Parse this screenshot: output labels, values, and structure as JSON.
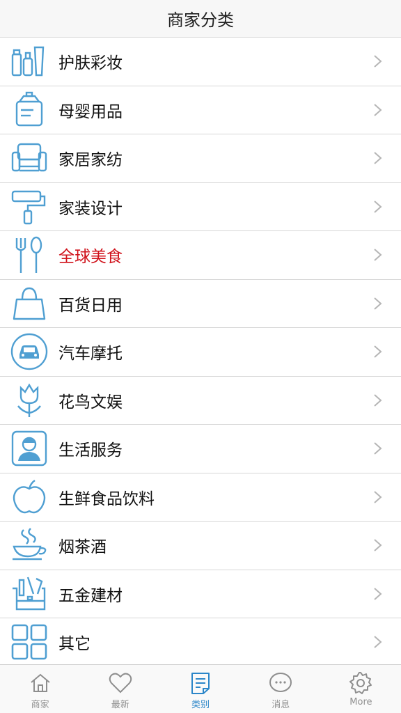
{
  "header": {
    "title": "商家分类"
  },
  "colors": {
    "accent": "#2b86c9",
    "icon_blue": "#4f9fd2",
    "highlight_red": "#d0121b"
  },
  "categories": [
    {
      "label": "护肤彩妆",
      "icon": "cosmetics-icon"
    },
    {
      "label": "母婴用品",
      "icon": "baby-bottle-icon"
    },
    {
      "label": "家居家纺",
      "icon": "sofa-icon"
    },
    {
      "label": "家装设计",
      "icon": "paint-roller-icon"
    },
    {
      "label": "全球美食",
      "icon": "fork-spoon-icon",
      "highlighted": true
    },
    {
      "label": "百货日用",
      "icon": "shopping-bag-icon"
    },
    {
      "label": "汽车摩托",
      "icon": "car-icon"
    },
    {
      "label": "花鸟文娱",
      "icon": "tulip-icon"
    },
    {
      "label": "生活服务",
      "icon": "service-person-icon"
    },
    {
      "label": "生鲜食品饮料",
      "icon": "apple-icon"
    },
    {
      "label": "烟茶酒",
      "icon": "teacup-icon"
    },
    {
      "label": "五金建材",
      "icon": "toolbox-icon"
    },
    {
      "label": "其它",
      "icon": "grid-icon"
    }
  ],
  "tabbar": {
    "tabs": [
      {
        "label": "商家",
        "icon": "home-icon"
      },
      {
        "label": "最新",
        "icon": "heart-icon"
      },
      {
        "label": "类别",
        "icon": "list-note-icon",
        "active": true
      },
      {
        "label": "消息",
        "icon": "chat-bubble-icon"
      },
      {
        "label": "More",
        "icon": "gear-icon"
      }
    ]
  }
}
